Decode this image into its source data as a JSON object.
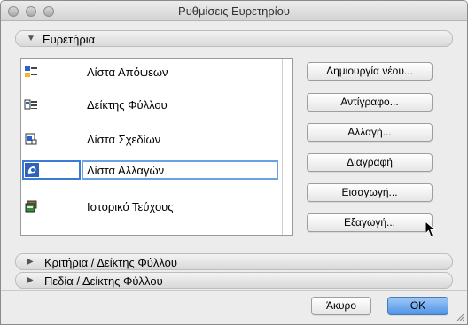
{
  "window": {
    "title": "Ρυθμίσεις Ευρετηρίου"
  },
  "sections": {
    "indexes": {
      "label": "Ευρετήρια",
      "expanded": true
    },
    "criteria": {
      "label": "Κριτήρια  /  Δείκτης Φύλλου",
      "expanded": false
    },
    "fields": {
      "label": "Πεδία  /  Δείκτης Φύλλου",
      "expanded": false
    }
  },
  "list": {
    "items": [
      {
        "label": "Λίστα Απόψεων",
        "icon": "view-list-icon"
      },
      {
        "label": "Δείκτης Φύλλου",
        "icon": "sheet-index-icon"
      },
      {
        "label": "Λίστα Σχεδίων",
        "icon": "drawing-list-icon"
      },
      {
        "label": "Λίστα Αλλαγών",
        "icon": "change-list-icon",
        "selected": true,
        "editing": true
      },
      {
        "label": "Ιστορικό Τεύχους",
        "icon": "issue-history-icon"
      }
    ]
  },
  "actions": {
    "create_new": "Δημιουργία νέου...",
    "duplicate": "Αντίγραφο...",
    "rename": "Αλλαγή...",
    "delete": "Διαγραφή",
    "import": "Εισαγωγή...",
    "export": "Εξαγωγή..."
  },
  "footer": {
    "cancel": "Άκυρο",
    "ok": "OK"
  },
  "colors": {
    "selection": "#3b7bd4",
    "ok_button": "#4f93e6"
  }
}
